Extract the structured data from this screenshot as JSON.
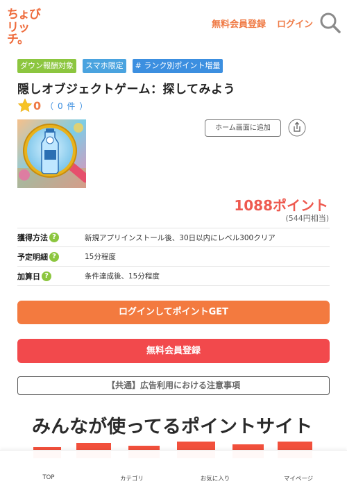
{
  "header": {
    "logo_line1": "ちょび",
    "logo_line2": "リッチ。",
    "register_label": "無料会員登録",
    "login_label": "ログイン",
    "search_icon": "search-icon"
  },
  "tags": [
    "ダウン報酬対象",
    "スマホ限定",
    "# ランク別ポイント増量"
  ],
  "offer": {
    "title": "隠しオブジェクトゲーム：探してみよう",
    "rating_value": "0",
    "rating_count": "（ 0 件 ）",
    "home_button_label": "ホーム画面に追加",
    "share_icon": "share-icon",
    "points": "1088ポイント",
    "points_yen": "(544円相当)"
  },
  "info_rows": [
    {
      "key": "獲得方法",
      "value": "新規アプリインストール後、30日以内にレベル300クリア"
    },
    {
      "key": "予定明細",
      "value": "15分程度"
    },
    {
      "key": "加算日",
      "value": "条件達成後、15分程度"
    }
  ],
  "buttons": {
    "login_get": "ログインしてポイントGET",
    "register": "無料会員登録",
    "notice": "【共通】広告利用における注意事項"
  },
  "banner": {
    "headline": "みんなが使ってるポイントサイト"
  },
  "tabbar": {
    "top": "TOP",
    "category": "カテゴリ",
    "favorites": "お気に入り",
    "mypage": "マイページ"
  },
  "colors": {
    "accent_orange": "#ef7a45",
    "points_red": "#ee5a50",
    "register_red": "#f2494c",
    "tag_green": "#8cc63f",
    "tag_blue": "#4aa3df"
  }
}
